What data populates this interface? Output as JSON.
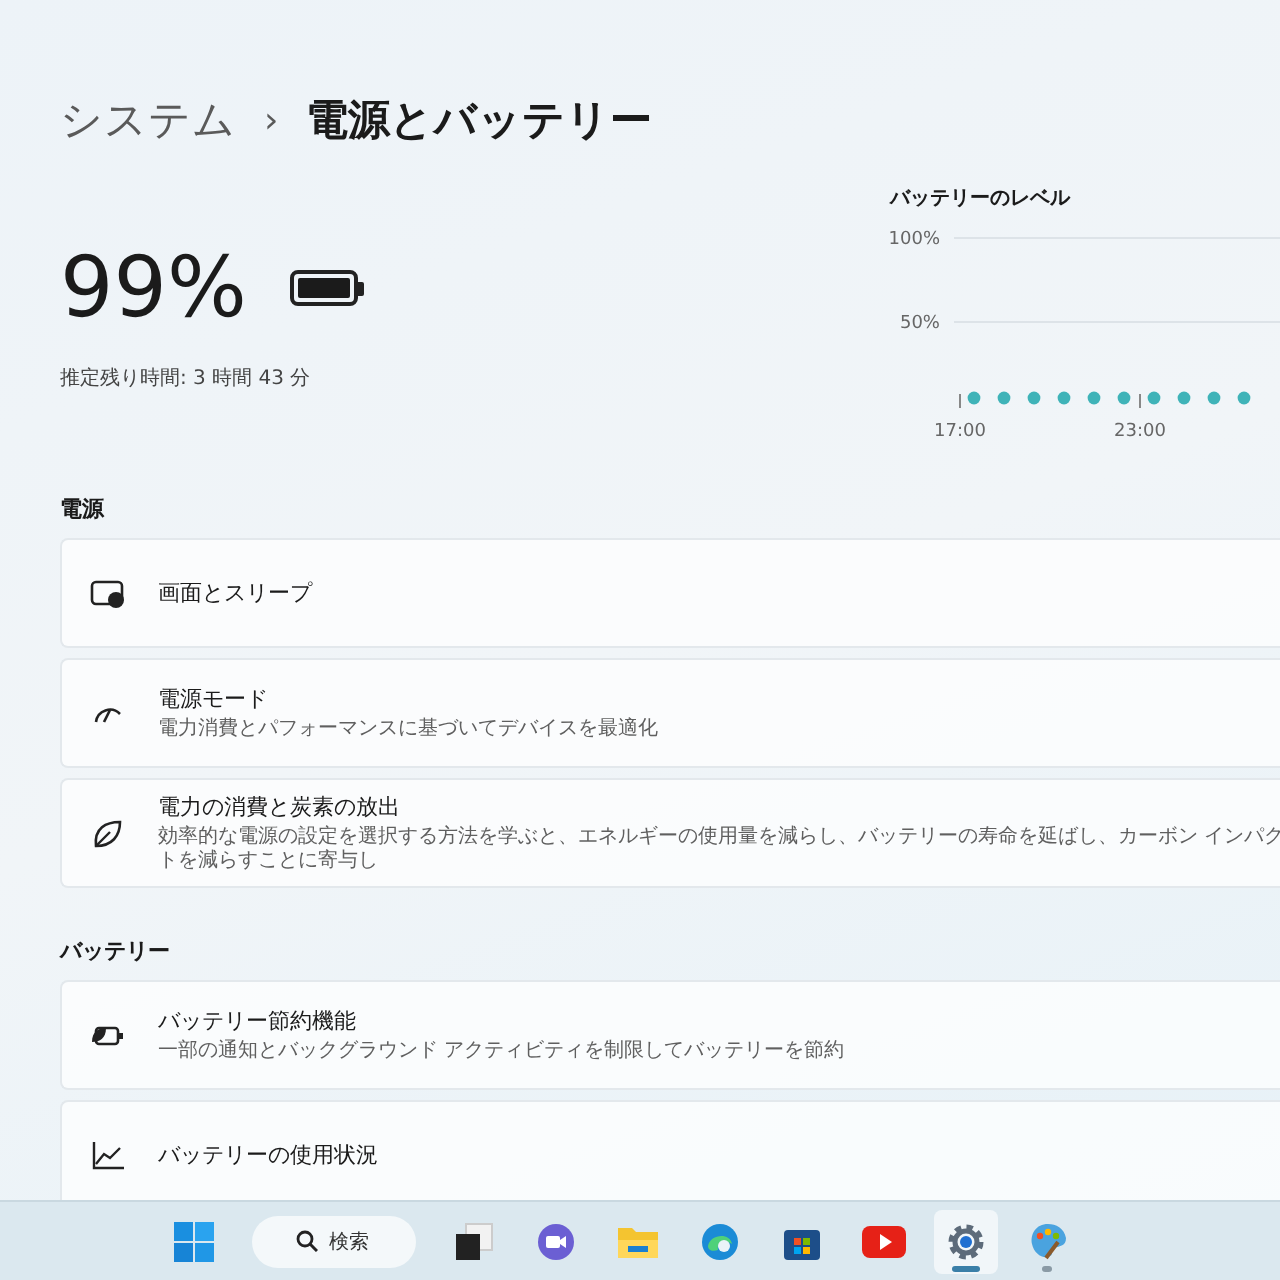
{
  "breadcrumb": {
    "parent": "システム",
    "separator": "›",
    "current": "電源とバッテリー"
  },
  "battery": {
    "percent": "99%",
    "estimate": "推定残り時間: 3 時間 43 分"
  },
  "battery_chart": {
    "title": "バッテリーのレベル",
    "y_labels": [
      "100%",
      "50%"
    ],
    "x_labels": [
      "17:00",
      "23:00"
    ]
  },
  "sections": [
    {
      "heading": "電源",
      "items": [
        {
          "kind": "sleep",
          "title": "画面とスリープ"
        },
        {
          "kind": "mode",
          "title": "電源モード",
          "subtitle": "電力消費とパフォーマンスに基づいてデバイスを最適化"
        },
        {
          "kind": "leaf",
          "title": "電力の消費と炭素の放出",
          "subtitle": "効率的な電源の設定を選択する方法を学ぶと、エネルギーの使用量を減らし、バッテリーの寿命を延ばし、カーボン インパクトを減らすことに寄与し"
        }
      ]
    },
    {
      "heading": "バッテリー",
      "items": [
        {
          "kind": "saver",
          "title": "バッテリー節約機能",
          "subtitle": "一部の通知とバックグラウンド アクティビティを制限してバッテリーを節約"
        },
        {
          "kind": "usage",
          "title": "バッテリーの使用状況"
        }
      ]
    }
  ],
  "taskbar": {
    "search": {
      "placeholder": "検索"
    },
    "apps": [
      {
        "kind": "start",
        "selected": false,
        "running": false
      },
      {
        "kind": "search"
      },
      {
        "kind": "taskview",
        "selected": false,
        "running": false
      },
      {
        "kind": "chat",
        "selected": false,
        "running": false
      },
      {
        "kind": "explorer",
        "selected": false,
        "running": false
      },
      {
        "kind": "edge",
        "selected": false,
        "running": false
      },
      {
        "kind": "store",
        "selected": false,
        "running": false
      },
      {
        "kind": "youtube",
        "selected": false,
        "running": false
      },
      {
        "kind": "settings",
        "selected": true,
        "running": true
      },
      {
        "kind": "paint",
        "selected": false,
        "running": true
      }
    ]
  }
}
